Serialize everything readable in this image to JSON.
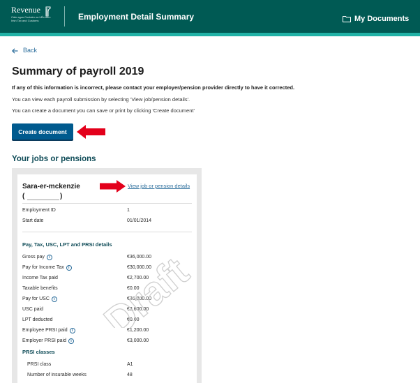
{
  "header": {
    "logo_name": "Revenue",
    "logo_sub": "Cáin agus Custaim na hÉireann Irish Tax and Customs",
    "title": "Employment Detail Summary",
    "my_documents": "My Documents",
    "bg_color": "#005a54",
    "stripe_color": "#21b2a6"
  },
  "nav": {
    "back_label": "Back",
    "back_icon": "arrow-left-icon"
  },
  "page": {
    "title": "Summary of payroll 2019",
    "intro_bold": "If any of this information is incorrect, please contact your employer/pension provider directly to have it corrected.",
    "intro_1": "You can view each payroll submission by selecting 'View job/pension details'.",
    "intro_2": "You can create a document you can save or print by clicking 'Create document'",
    "create_button": "Create document",
    "section_title": "Your jobs or pensions"
  },
  "employment": {
    "name": "Sara-er-mckenzie",
    "paren_open": "(",
    "paren_close": ")",
    "view_link": "View job or pension details",
    "id_label": "Employment ID",
    "id_value": "1",
    "start_label": "Start date",
    "start_value": "01/01/2014",
    "pay_section_title": "Pay, Tax, USC, LPT and PRSI details",
    "pay_rows": [
      {
        "label": "Gross pay",
        "value": "€36,000.00",
        "info": true
      },
      {
        "label": "Pay for Income Tax",
        "value": "€30,000.00",
        "info": true
      },
      {
        "label": "Income Tax paid",
        "value": "€2,700.00",
        "info": false
      },
      {
        "label": "Taxable benefits",
        "value": "€0.00",
        "info": false
      },
      {
        "label": "Pay for USC",
        "value": "€36,000.00",
        "info": true
      },
      {
        "label": "USC paid",
        "value": "€3,600.00",
        "info": false
      },
      {
        "label": "LPT deducted",
        "value": "€0.00",
        "info": false
      },
      {
        "label": "Employee PRSI paid",
        "value": "€1,200.00",
        "info": true
      },
      {
        "label": "Employer PRSI paid",
        "value": "€3,000.00",
        "info": true
      }
    ],
    "prsi_section_title": "PRSI classes",
    "prsi_class_label": "PRSI class",
    "prsi_class_value": "A1",
    "weeks_label": "Number of insurable weeks",
    "weeks_value": "48"
  },
  "watermark": "Draft",
  "annotation_color": "#e3001b",
  "link_color": "#2c6e9c",
  "button_color": "#005a8e"
}
